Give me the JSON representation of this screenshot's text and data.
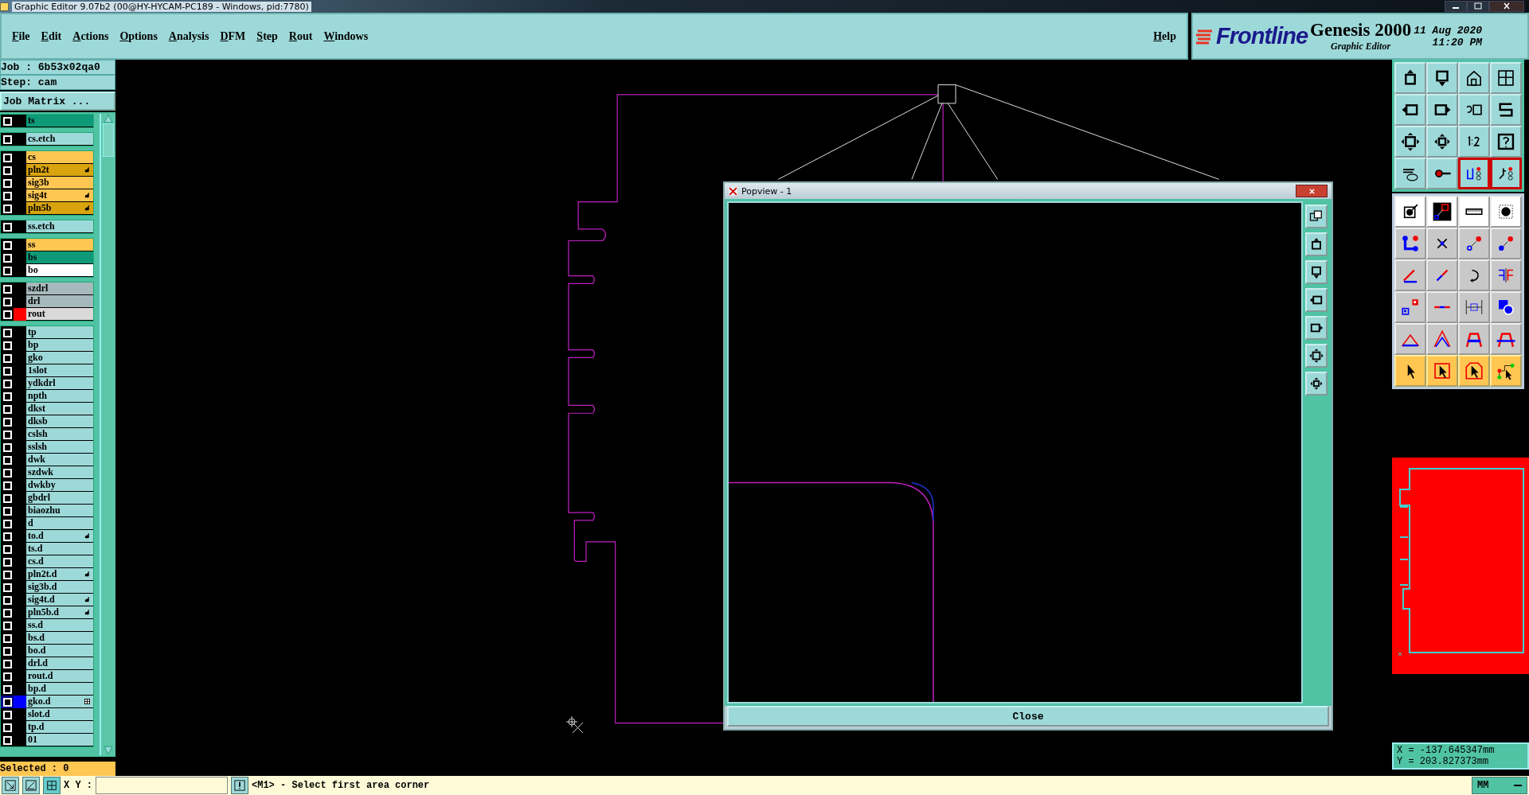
{
  "window": {
    "title": "Graphic Editor 9.07b2 (00@HY-HYCAM-PC189 - Windows, pid:7780)"
  },
  "menu": [
    "File",
    "Edit",
    "Actions",
    "Options",
    "Analysis",
    "DFM",
    "Step",
    "Rout",
    "Windows"
  ],
  "help": "Help",
  "brand": {
    "logo": "Frontline",
    "product": "Genesis 2000",
    "subtitle": "Graphic Editor",
    "date": "11 Aug 2020",
    "time": "11:20 PM"
  },
  "job": {
    "job_label": "Job : 6b53x02qa0",
    "step_label": "Step: cam",
    "matrix_button": "Job Matrix ..."
  },
  "layer_groups": [
    [
      {
        "name": "ts",
        "color": "#0e9a78",
        "selected": false,
        "kind": "plain"
      }
    ],
    [
      {
        "name": "cs.etch",
        "color": "#9ed9d9",
        "selected": false,
        "kind": "plain"
      }
    ],
    [
      {
        "name": "cs",
        "color": "#ffc652",
        "selected": false,
        "kind": "plain"
      },
      {
        "name": "pln2t",
        "color": "#d9a40e",
        "selected": false,
        "kind": "hand"
      },
      {
        "name": "sig3b",
        "color": "#ffc652",
        "selected": false,
        "kind": "plain"
      },
      {
        "name": "sig4t",
        "color": "#ffc652",
        "selected": false,
        "kind": "hand"
      },
      {
        "name": "pln5b",
        "color": "#d9a40e",
        "selected": false,
        "kind": "hand"
      }
    ],
    [
      {
        "name": "ss.etch",
        "color": "#9ed9d9",
        "selected": false,
        "kind": "plain"
      }
    ],
    [
      {
        "name": "ss",
        "color": "#ffc652",
        "selected": false,
        "kind": "plain"
      },
      {
        "name": "bs",
        "color": "#0e9a78",
        "selected": false,
        "kind": "plain"
      },
      {
        "name": "bo",
        "color": "#ffffff",
        "selected": false,
        "kind": "plain"
      }
    ],
    [
      {
        "name": "szdrl",
        "color": "#a6b9bd",
        "selected": false,
        "kind": "plain"
      },
      {
        "name": "drl",
        "color": "#a6b9bd",
        "selected": false,
        "kind": "plain"
      },
      {
        "name": "rout",
        "color": "#d9d9d9",
        "selected": false,
        "kind": "plain",
        "swatch": {
          "color": "#ff0000"
        }
      }
    ],
    [
      {
        "name": "tp",
        "color": "#9ed9d9",
        "selected": false,
        "kind": "plain"
      },
      {
        "name": "bp",
        "color": "#9ed9d9",
        "selected": false,
        "kind": "plain"
      },
      {
        "name": "gko",
        "color": "#9ed9d9",
        "selected": false,
        "kind": "plain"
      },
      {
        "name": "1slot",
        "color": "#9ed9d9",
        "selected": false,
        "kind": "plain"
      },
      {
        "name": "ydkdrl",
        "color": "#9ed9d9",
        "selected": false,
        "kind": "plain"
      },
      {
        "name": "npth",
        "color": "#9ed9d9",
        "selected": false,
        "kind": "plain"
      },
      {
        "name": "dkst",
        "color": "#9ed9d9",
        "selected": false,
        "kind": "plain"
      },
      {
        "name": "dksb",
        "color": "#9ed9d9",
        "selected": false,
        "kind": "plain"
      },
      {
        "name": "cslsh",
        "color": "#9ed9d9",
        "selected": false,
        "kind": "plain"
      },
      {
        "name": "sslsh",
        "color": "#9ed9d9",
        "selected": false,
        "kind": "plain"
      },
      {
        "name": "dwk",
        "color": "#9ed9d9",
        "selected": false,
        "kind": "plain"
      },
      {
        "name": "szdwk",
        "color": "#9ed9d9",
        "selected": false,
        "kind": "plain"
      },
      {
        "name": "dwkby",
        "color": "#9ed9d9",
        "selected": false,
        "kind": "plain"
      },
      {
        "name": "gbdrl",
        "color": "#9ed9d9",
        "selected": false,
        "kind": "plain"
      },
      {
        "name": "biaozhu",
        "color": "#9ed9d9",
        "selected": false,
        "kind": "plain"
      },
      {
        "name": "d",
        "color": "#9ed9d9",
        "selected": false,
        "kind": "plain"
      },
      {
        "name": "to.d",
        "color": "#9ed9d9",
        "selected": false,
        "kind": "hand"
      },
      {
        "name": "ts.d",
        "color": "#9ed9d9",
        "selected": false,
        "kind": "plain"
      },
      {
        "name": "cs.d",
        "color": "#9ed9d9",
        "selected": false,
        "kind": "plain"
      },
      {
        "name": "pln2t.d",
        "color": "#9ed9d9",
        "selected": false,
        "kind": "hand"
      },
      {
        "name": "sig3b.d",
        "color": "#9ed9d9",
        "selected": false,
        "kind": "plain"
      },
      {
        "name": "sig4t.d",
        "color": "#9ed9d9",
        "selected": false,
        "kind": "hand"
      },
      {
        "name": "pln5b.d",
        "color": "#9ed9d9",
        "selected": false,
        "kind": "hand"
      },
      {
        "name": "ss.d",
        "color": "#9ed9d9",
        "selected": false,
        "kind": "plain"
      },
      {
        "name": "bs.d",
        "color": "#9ed9d9",
        "selected": false,
        "kind": "plain"
      },
      {
        "name": "bo.d",
        "color": "#9ed9d9",
        "selected": false,
        "kind": "plain"
      },
      {
        "name": "drl.d",
        "color": "#9ed9d9",
        "selected": false,
        "kind": "plain"
      },
      {
        "name": "rout.d",
        "color": "#9ed9d9",
        "selected": false,
        "kind": "plain"
      },
      {
        "name": "bp.d",
        "color": "#9ed9d9",
        "selected": false,
        "kind": "plain"
      },
      {
        "name": "gko.d",
        "color": "#9ed9d9",
        "selected": true,
        "kind": "grid",
        "swatch": {
          "color": "#0000ff"
        }
      },
      {
        "name": "slot.d",
        "color": "#9ed9d9",
        "selected": false,
        "kind": "plain"
      },
      {
        "name": "tp.d",
        "color": "#9ed9d9",
        "selected": false,
        "kind": "plain"
      },
      {
        "name": "01",
        "color": "#9ed9d9",
        "selected": false,
        "kind": "plain"
      }
    ]
  ],
  "selected_count": "Selected : 0",
  "popview": {
    "title": "Popview - 1",
    "close_button": "Close"
  },
  "coordinates": {
    "x": "X = -137.645347mm",
    "y": "Y = 203.827373mm"
  },
  "status_bar": {
    "xy_label": "X Y :",
    "message": "<M1> - Select first area corner",
    "units": "MM"
  }
}
